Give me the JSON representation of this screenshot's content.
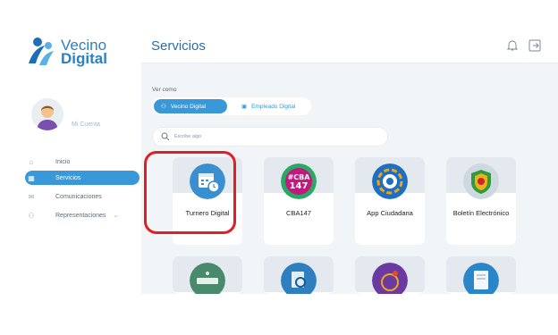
{
  "brand": {
    "line1": "Vecino",
    "line2": "Digital",
    "color": "#2a7fc7"
  },
  "header": {
    "title": "Servicios"
  },
  "user": {
    "account_label": "Mi Cuenta"
  },
  "nav": [
    {
      "label": "Inicio",
      "icon": "home-icon",
      "active": false
    },
    {
      "label": "Servicios",
      "icon": "grid-icon",
      "active": true
    },
    {
      "label": "Comunicaciones",
      "icon": "mail-icon",
      "active": false
    },
    {
      "label": "Representaciones",
      "icon": "people-icon",
      "active": false
    }
  ],
  "view": {
    "label": "Ver como",
    "options": [
      {
        "label": "Vecino Digital",
        "selected": true
      },
      {
        "label": "Empleado Digital",
        "selected": false
      }
    ]
  },
  "search": {
    "placeholder": "Escribe algo"
  },
  "services": [
    {
      "label": "Turnero Digital",
      "icon": "calendar-clock-icon",
      "highlighted": true
    },
    {
      "label": "CBA147",
      "icon": "cba147-logo"
    },
    {
      "label": "App Ciudadana",
      "icon": "app-ciudadana-logo"
    },
    {
      "label": "Boletín Electrónico",
      "icon": "shield-icon"
    }
  ],
  "services_row2": [
    {
      "label": "",
      "icon": "ciudad-logo"
    },
    {
      "label": "",
      "icon": "search-document-icon"
    },
    {
      "label": "",
      "icon": "purple-logo"
    },
    {
      "label": "",
      "icon": "document-house-icon"
    }
  ],
  "colors": {
    "accent": "#3a98d8",
    "highlight": "#e01e24"
  }
}
